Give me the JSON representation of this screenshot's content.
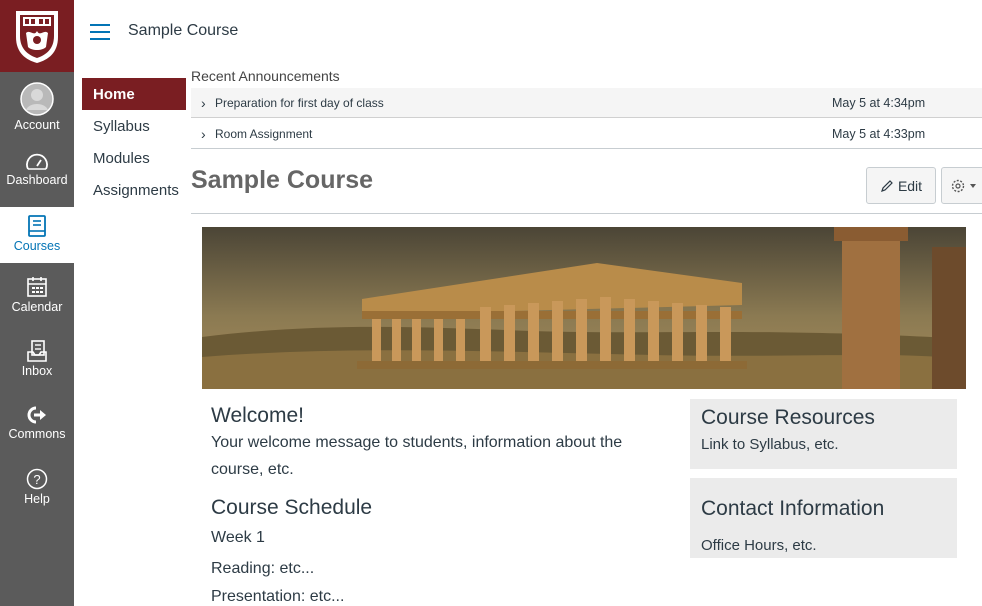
{
  "global_nav": {
    "items": [
      {
        "label": "Account",
        "icon": "user-avatar-icon"
      },
      {
        "label": "Dashboard",
        "icon": "dashboard-icon"
      },
      {
        "label": "Courses",
        "icon": "book-icon",
        "active": true
      },
      {
        "label": "Calendar",
        "icon": "calendar-icon"
      },
      {
        "label": "Inbox",
        "icon": "inbox-icon"
      },
      {
        "label": "Commons",
        "icon": "commons-icon"
      },
      {
        "label": "Help",
        "icon": "help-icon"
      }
    ]
  },
  "header": {
    "breadcrumb": "Sample Course"
  },
  "course_nav": {
    "items": [
      {
        "label": "Home",
        "active": true
      },
      {
        "label": "Syllabus"
      },
      {
        "label": "Modules"
      },
      {
        "label": "Assignments"
      }
    ]
  },
  "announcements": {
    "heading": "Recent Announcements",
    "items": [
      {
        "title": "Preparation for first day of class",
        "date": "May 5 at 4:34pm"
      },
      {
        "title": "Room Assignment",
        "date": "May 5 at 4:33pm"
      }
    ]
  },
  "page": {
    "title": "Sample Course",
    "edit_label": "Edit"
  },
  "content": {
    "welcome_heading": "Welcome!",
    "welcome_line1": "Your welcome message to students, information about the",
    "welcome_line2": "course, etc.",
    "schedule_heading": "Course Schedule",
    "schedule_week": "Week 1",
    "schedule_reading": "Reading: etc...",
    "schedule_presentation": "Presentation: etc...",
    "resources_heading": "Course Resources",
    "resources_text": "Link to Syllabus, etc.",
    "contact_heading": "Contact Information",
    "contact_text": "Office Hours, etc."
  },
  "colors": {
    "brand": "#7a1e22",
    "nav_bg": "#5b5b5b",
    "link": "#0374b5"
  }
}
